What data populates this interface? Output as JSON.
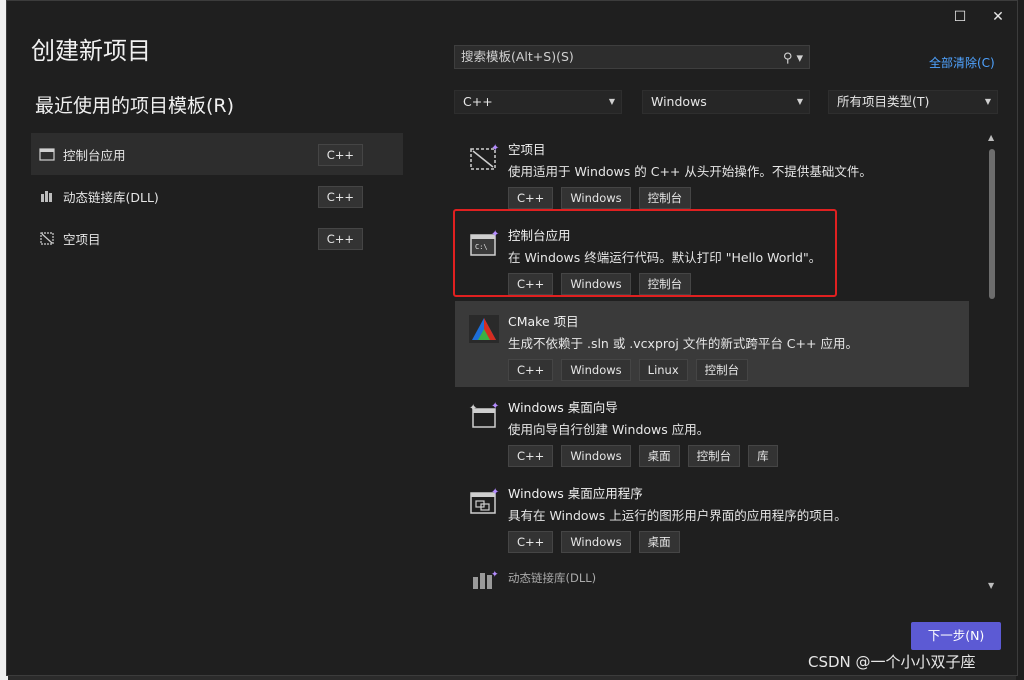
{
  "window": {
    "maximize_glyph": "☐",
    "close_glyph": "✕"
  },
  "title": "创建新项目",
  "recent": {
    "heading": "最近使用的项目模板(R)",
    "items": [
      {
        "label": "控制台应用",
        "tag": "C++",
        "icon": "console-app-icon"
      },
      {
        "label": "动态链接库(DLL)",
        "tag": "C++",
        "icon": "dll-icon"
      },
      {
        "label": "空项目",
        "tag": "C++",
        "icon": "empty-project-icon"
      }
    ]
  },
  "search": {
    "placeholder": "搜索模板(Alt+S)(S)",
    "icon": "search-icon"
  },
  "clear_all": "全部清除(C)",
  "filters": {
    "language": "C++",
    "platform": "Windows",
    "project_type": "所有项目类型(T)"
  },
  "templates": [
    {
      "name": "空项目",
      "desc": "使用适用于 Windows 的 C++ 从头开始操作。不提供基础文件。",
      "tags": [
        "C++",
        "Windows",
        "控制台"
      ],
      "icon": "empty-project-icon"
    },
    {
      "name": "控制台应用",
      "desc": "在 Windows 终端运行代码。默认打印 \"Hello World\"。",
      "tags": [
        "C++",
        "Windows",
        "控制台"
      ],
      "icon": "console-app-icon"
    },
    {
      "name": "CMake 项目",
      "desc": "生成不依赖于 .sln 或 .vcxproj 文件的新式跨平台 C++ 应用。",
      "tags": [
        "C++",
        "Windows",
        "Linux",
        "控制台"
      ],
      "icon": "cmake-icon"
    },
    {
      "name": "Windows 桌面向导",
      "desc": "使用向导自行创建 Windows 应用。",
      "tags": [
        "C++",
        "Windows",
        "桌面",
        "控制台",
        "库"
      ],
      "icon": "desktop-wizard-icon"
    },
    {
      "name": "Windows 桌面应用程序",
      "desc": "具有在 Windows 上运行的图形用户界面的应用程序的项目。",
      "tags": [
        "C++",
        "Windows",
        "桌面"
      ],
      "icon": "desktop-app-icon"
    },
    {
      "name": "动态链接库(DLL)",
      "icon": "dll-icon"
    }
  ],
  "next_button": "下一步(N)",
  "watermark": "CSDN @一个小小双子座",
  "colors": {
    "accent": "#5c5ad4",
    "highlight_border": "#e02020",
    "link": "#4fa3ff"
  }
}
